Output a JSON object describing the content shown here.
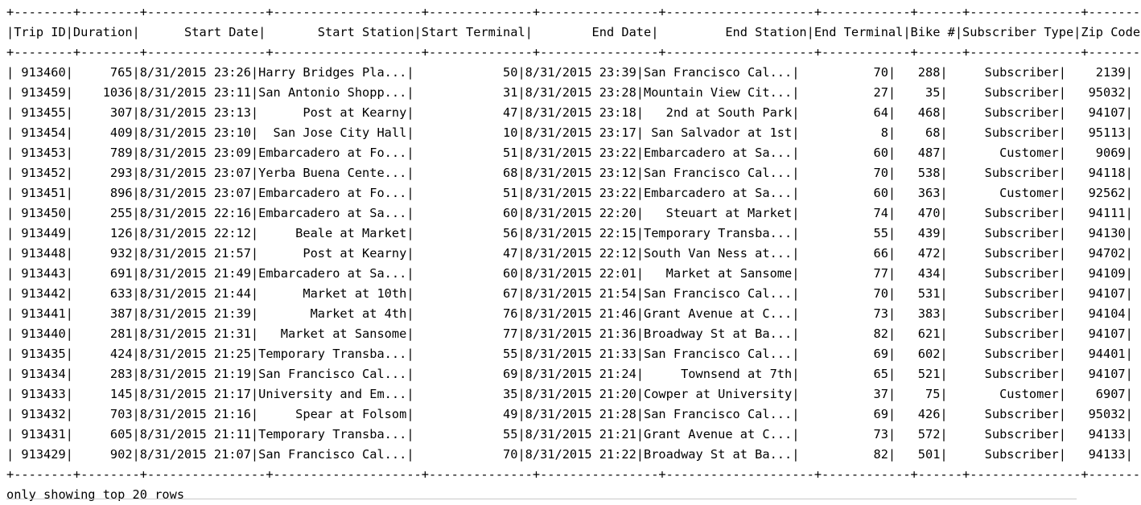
{
  "table": {
    "border": "+--------+--------+----------------+--------------------+--------------+----------------+--------------------+------------+------+---------------+--------+",
    "header": "|Trip ID|Duration|      Start Date|       Start Station|Start Terminal|        End Date|         End Station|End Terminal|Bike #|Subscriber Type|Zip Code|",
    "rows": [
      "| 913460|     765|8/31/2015 23:26|Harry Bridges Pla...|            50|8/31/2015 23:39|San Francisco Cal...|          70|   288|     Subscriber|    2139|",
      "| 913459|    1036|8/31/2015 23:11|San Antonio Shopp...|            31|8/31/2015 23:28|Mountain View Cit...|          27|    35|     Subscriber|   95032|",
      "| 913455|     307|8/31/2015 23:13|      Post at Kearny|            47|8/31/2015 23:18|   2nd at South Park|          64|   468|     Subscriber|   94107|",
      "| 913454|     409|8/31/2015 23:10|  San Jose City Hall|            10|8/31/2015 23:17| San Salvador at 1st|           8|    68|     Subscriber|   95113|",
      "| 913453|     789|8/31/2015 23:09|Embarcadero at Fo...|            51|8/31/2015 23:22|Embarcadero at Sa...|          60|   487|       Customer|    9069|",
      "| 913452|     293|8/31/2015 23:07|Yerba Buena Cente...|            68|8/31/2015 23:12|San Francisco Cal...|          70|   538|     Subscriber|   94118|",
      "| 913451|     896|8/31/2015 23:07|Embarcadero at Fo...|            51|8/31/2015 23:22|Embarcadero at Sa...|          60|   363|       Customer|   92562|",
      "| 913450|     255|8/31/2015 22:16|Embarcadero at Sa...|            60|8/31/2015 22:20|   Steuart at Market|          74|   470|     Subscriber|   94111|",
      "| 913449|     126|8/31/2015 22:12|     Beale at Market|            56|8/31/2015 22:15|Temporary Transba...|          55|   439|     Subscriber|   94130|",
      "| 913448|     932|8/31/2015 21:57|      Post at Kearny|            47|8/31/2015 22:12|South Van Ness at...|          66|   472|     Subscriber|   94702|",
      "| 913443|     691|8/31/2015 21:49|Embarcadero at Sa...|            60|8/31/2015 22:01|   Market at Sansome|          77|   434|     Subscriber|   94109|",
      "| 913442|     633|8/31/2015 21:44|      Market at 10th|            67|8/31/2015 21:54|San Francisco Cal...|          70|   531|     Subscriber|   94107|",
      "| 913441|     387|8/31/2015 21:39|       Market at 4th|            76|8/31/2015 21:46|Grant Avenue at C...|          73|   383|     Subscriber|   94104|",
      "| 913440|     281|8/31/2015 21:31|   Market at Sansome|            77|8/31/2015 21:36|Broadway St at Ba...|          82|   621|     Subscriber|   94107|",
      "| 913435|     424|8/31/2015 21:25|Temporary Transba...|            55|8/31/2015 21:33|San Francisco Cal...|          69|   602|     Subscriber|   94401|",
      "| 913434|     283|8/31/2015 21:19|San Francisco Cal...|            69|8/31/2015 21:24|     Townsend at 7th|          65|   521|     Subscriber|   94107|",
      "| 913433|     145|8/31/2015 21:17|University and Em...|            35|8/31/2015 21:20|Cowper at University|          37|    75|       Customer|    6907|",
      "| 913432|     703|8/31/2015 21:16|     Spear at Folsom|            49|8/31/2015 21:28|San Francisco Cal...|          69|   426|     Subscriber|   95032|",
      "| 913431|     605|8/31/2015 21:11|Temporary Transba...|            55|8/31/2015 21:21|Grant Avenue at C...|          73|   572|     Subscriber|   94133|",
      "| 913429|     902|8/31/2015 21:07|San Francisco Cal...|            70|8/31/2015 21:22|Broadway St at Ba...|          82|   501|     Subscriber|   94133|"
    ]
  },
  "footer": "only showing top 20 rows"
}
